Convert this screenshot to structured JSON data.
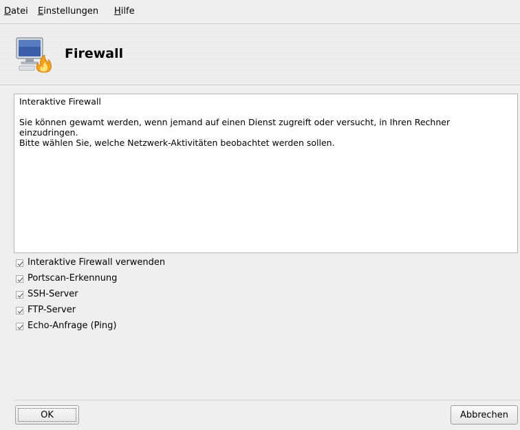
{
  "menubar": {
    "items": [
      {
        "label": "Datei"
      },
      {
        "label": "Einstellungen"
      },
      {
        "label": "Hilfe"
      }
    ]
  },
  "banner": {
    "title": "Firewall",
    "icon": "firewall-computer-flame-icon"
  },
  "info": {
    "heading": "Interaktive Firewall",
    "line1": "Sie können gewamt werden, wenn jemand auf einen Dienst zugreift oder versucht, in Ihren Rechner",
    "line2": "einzudringen.",
    "line3": "Bitte wählen Sie, welche Netzwerk-Aktivitäten beobachtet werden sollen."
  },
  "options": [
    {
      "label": "Interaktive Firewall verwenden",
      "checked": true
    },
    {
      "label": "Portscan-Erkennung",
      "checked": true
    },
    {
      "label": "SSH-Server",
      "checked": true
    },
    {
      "label": "FTP-Server",
      "checked": true
    },
    {
      "label": "Echo-Anfrage (Ping)",
      "checked": true
    }
  ],
  "buttons": {
    "ok": "OK",
    "cancel": "Abbrechen"
  }
}
